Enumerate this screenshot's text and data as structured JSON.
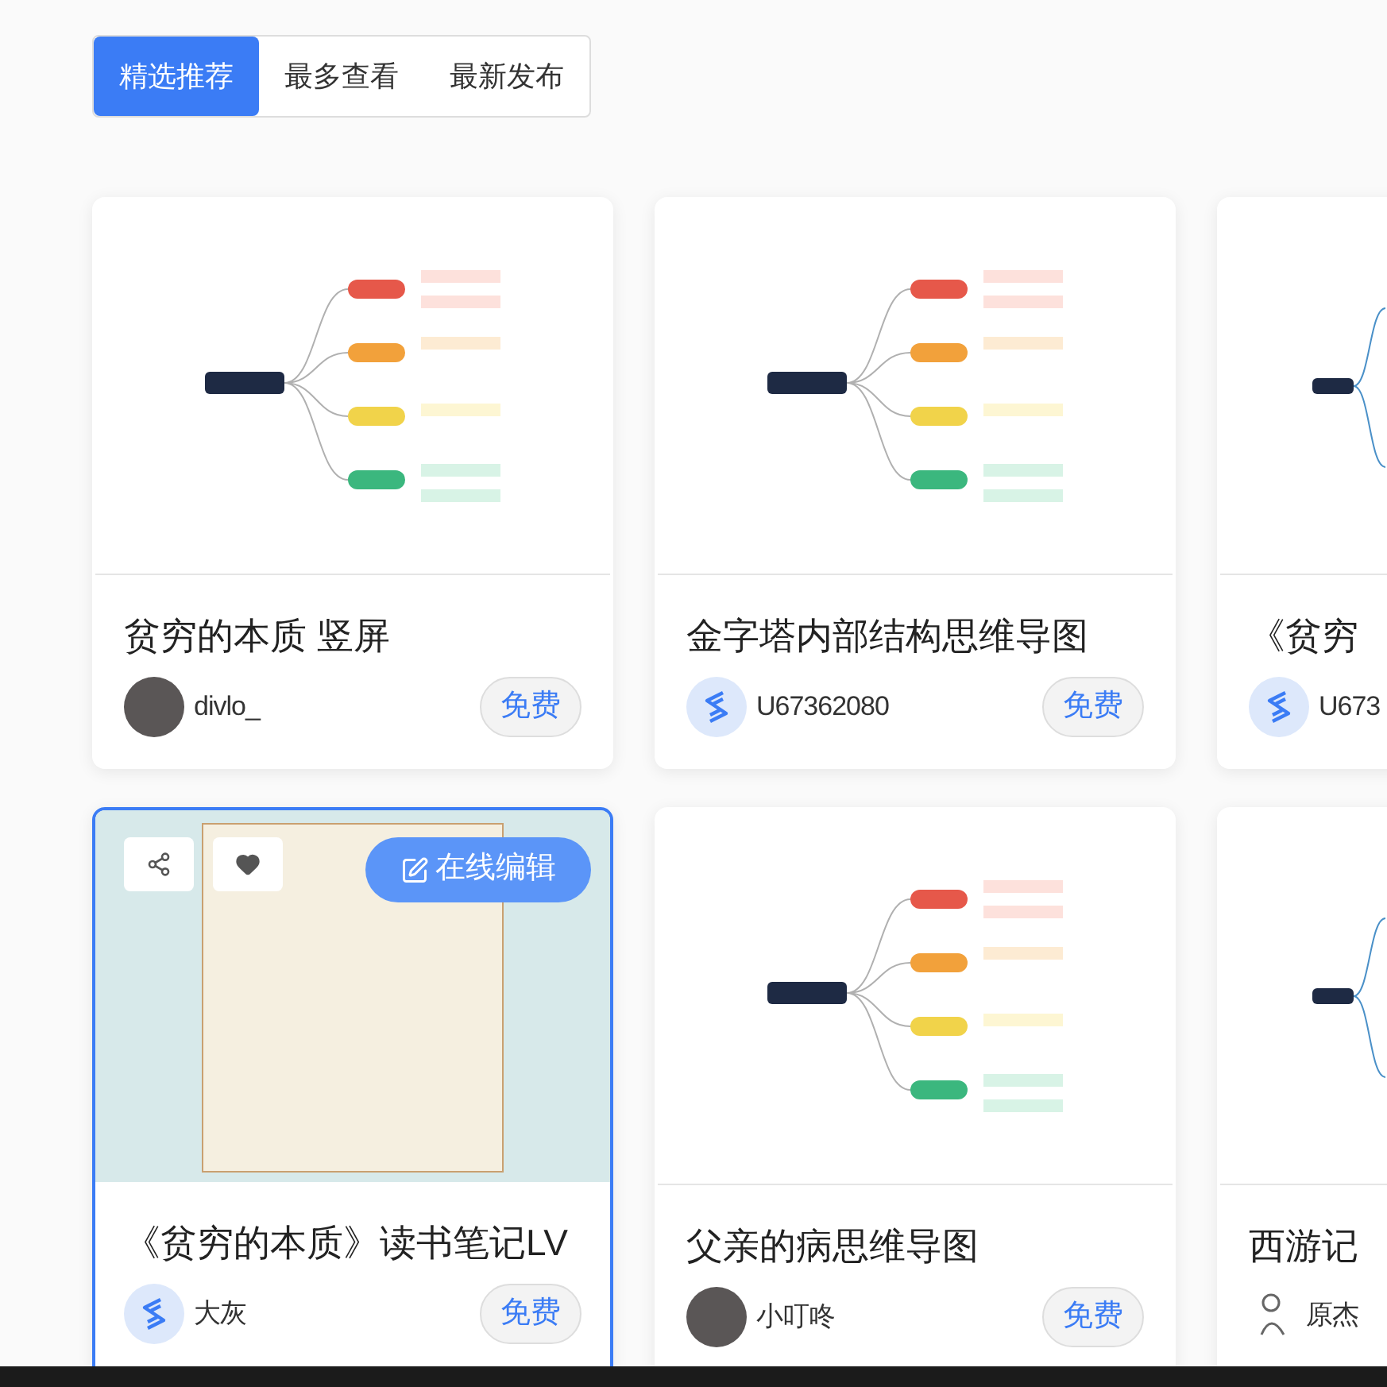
{
  "tabs": [
    {
      "label": "精选推荐",
      "selected": true
    },
    {
      "label": "最多查看",
      "selected": false
    },
    {
      "label": "最新发布",
      "selected": false
    }
  ],
  "cards": [
    {
      "title": "贫穷的本质 竖屏",
      "author": "divlo_",
      "avatar": {
        "kind": "photo"
      },
      "badge": "免费",
      "thumbnail": {
        "kind": "mindmap"
      },
      "hovered": false
    },
    {
      "title": "金字塔内部结构思维导图",
      "author": "U67362080",
      "avatar": {
        "kind": "logo"
      },
      "badge": "免费",
      "thumbnail": {
        "kind": "mindmap"
      },
      "hovered": false
    },
    {
      "title": "《贫穷",
      "author": "U673",
      "avatar": {
        "kind": "logo"
      },
      "thumbnail": {
        "kind": "partial"
      },
      "hovered": false
    },
    {
      "title": "《贫穷的本质》读书笔记LV",
      "author": "大灰",
      "avatar": {
        "kind": "logo"
      },
      "badge": "免费",
      "thumbnail": {
        "kind": "document"
      },
      "hovered": true,
      "edit_label": "在线编辑"
    },
    {
      "title": "父亲的病思维导图",
      "author": "小叮咚",
      "avatar": {
        "kind": "photo"
      },
      "badge": "免费",
      "thumbnail": {
        "kind": "mindmap"
      },
      "hovered": false
    },
    {
      "title": "西游记",
      "author": "原杰",
      "avatar": {
        "kind": "sketch"
      },
      "thumbnail": {
        "kind": "partial"
      },
      "hovered": false
    }
  ]
}
